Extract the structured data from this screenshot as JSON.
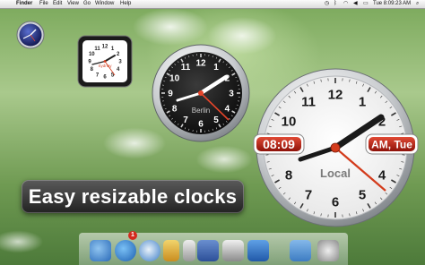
{
  "menubar": {
    "apple": "",
    "app_name": "Finder",
    "items": [
      "File",
      "Edit",
      "View",
      "Go",
      "Window",
      "Help"
    ],
    "status_icons": [
      "time-machine-icon",
      "bluetooth-icon",
      "wifi-icon",
      "volume-icon",
      "battery-icon"
    ],
    "clock": "Tue 8:09:23 AM",
    "search_icon": "spotlight-search-icon"
  },
  "widgets": {
    "small_clock": {
      "label": "Sydney"
    },
    "berlin_clock": {
      "label": "Berlin"
    },
    "local_clock": {
      "label": "Local",
      "digital_time": "08:09",
      "period_day": "AM, Tue"
    },
    "numerals": [
      "12",
      "1",
      "2",
      "3",
      "4",
      "5",
      "6",
      "7",
      "8",
      "9",
      "10",
      "11"
    ]
  },
  "banner": {
    "text": "Easy resizable clocks"
  },
  "dock": {
    "items": [
      "finder-icon",
      "app-store-icon",
      "safari-icon",
      "notes-icon",
      "calendar-icon",
      "address-book-icon",
      "photo-booth-icon",
      "weather-widget-icon",
      "folder-icon",
      "trash-icon"
    ],
    "badge": "1"
  },
  "colors": {
    "accent_red": "#d33b1b",
    "digital_red": "#b0180c",
    "berlin_face": "#1a1a1a"
  }
}
